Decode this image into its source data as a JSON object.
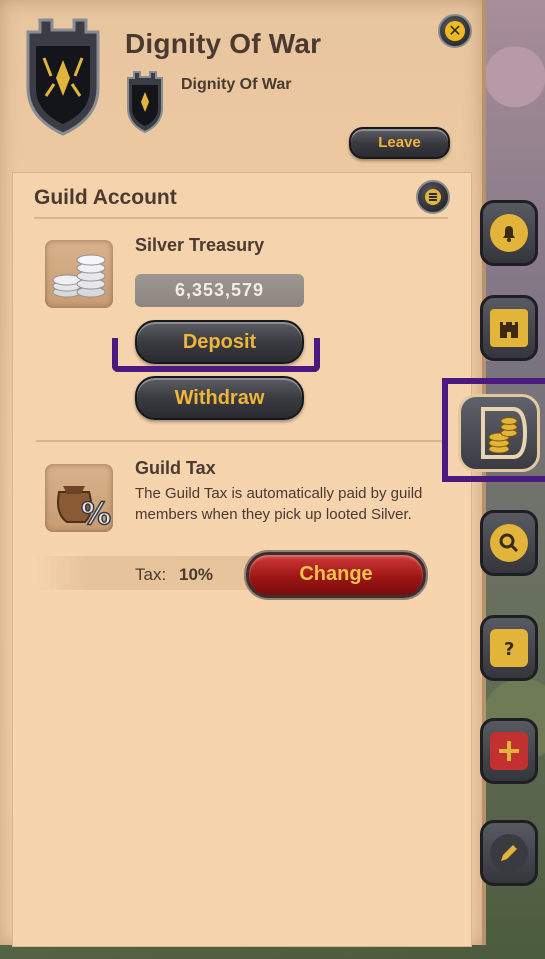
{
  "header": {
    "guild_name": "Dignity Of War",
    "alliance_name": "Dignity Of War",
    "leave_label": "Leave"
  },
  "close_icon": "close-icon",
  "guild_account": {
    "title": "Guild Account",
    "silver_treasury_label": "Silver Treasury",
    "silver_amount": "6,353,579",
    "deposit_label": "Deposit",
    "withdraw_label": "Withdraw",
    "tax_title": "Guild Tax",
    "tax_description": "The Guild Tax is automatically paid by guild members when they pick up looted Silver.",
    "tax_label": "Tax:",
    "tax_value": "10%",
    "change_label": "Change"
  },
  "side_tabs": [
    {
      "icon": "bell-icon"
    },
    {
      "icon": "castle-icon"
    },
    {
      "icon": "coins-icon",
      "active": true
    },
    {
      "icon": "search-icon"
    },
    {
      "icon": "question-shield-icon"
    },
    {
      "icon": "heraldry-shield-icon"
    },
    {
      "icon": "pen-icon"
    }
  ],
  "colors": {
    "panel_bg": "#f2cfa7",
    "gold_text": "#f0b53a",
    "annotation": "#4b1a80",
    "change_red": "#9e1515"
  }
}
